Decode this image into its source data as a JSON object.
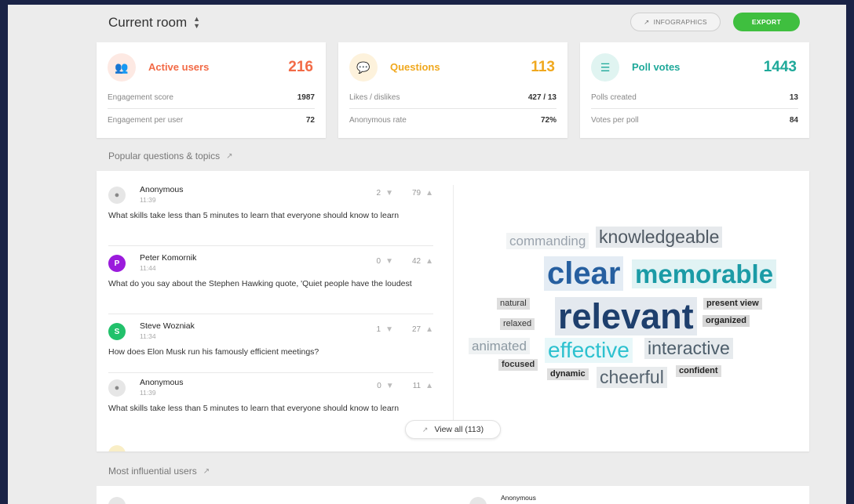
{
  "header": {
    "room_title": "Current room",
    "infographics_label": "INFOGRAPHICS",
    "export_label": "EXPORT"
  },
  "cards": [
    {
      "label": "Active users",
      "value": "216",
      "color": "#f26a46",
      "icon_bg": "#fde9e3",
      "icon": "users-icon",
      "rows": [
        {
          "label": "Engagement score",
          "value": "1987"
        },
        {
          "label": "Engagement per user",
          "value": "72"
        }
      ]
    },
    {
      "label": "Questions",
      "value": "113",
      "color": "#f0a81e",
      "icon_bg": "#fdf2dc",
      "icon": "speech-bubble-icon",
      "rows": [
        {
          "label": "Likes / dislikes",
          "value": "427 / 13"
        },
        {
          "label": "Anonymous rate",
          "value": "72%"
        }
      ]
    },
    {
      "label": "Poll votes",
      "value": "1443",
      "color": "#1fa99a",
      "icon_bg": "#e0f4f1",
      "icon": "poll-icon",
      "rows": [
        {
          "label": "Polls created",
          "value": "13"
        },
        {
          "label": "Votes per poll",
          "value": "84"
        }
      ]
    }
  ],
  "popular_section": {
    "title": "Popular questions & topics",
    "questions": [
      {
        "name": "Anonymous",
        "time": "11:39",
        "dislikes": "2",
        "likes": "79",
        "text": "What skills take less than 5 minutes to learn that everyone should know to learn",
        "avatar_letter": "",
        "avatar_color": "#e6e6e6"
      },
      {
        "name": "Peter Komornik",
        "time": "11:44",
        "dislikes": "0",
        "likes": "42",
        "text": "What do you say about the Stephen Hawking quote, 'Quiet people have the loudest",
        "avatar_letter": "P",
        "avatar_color": "#9b1bdc"
      },
      {
        "name": "Steve Wozniak",
        "time": "11:34",
        "dislikes": "1",
        "likes": "27",
        "text": "How does Elon Musk run his famously efficient meetings?",
        "avatar_letter": "S",
        "avatar_color": "#22c16b"
      },
      {
        "name": "Anonymous",
        "time": "11:39",
        "dislikes": "0",
        "likes": "11",
        "text": "What skills take less than 5 minutes to learn that everyone should know to learn",
        "avatar_letter": "",
        "avatar_color": "#e6e6e6"
      }
    ],
    "view_all_label": "View all (113)"
  },
  "word_cloud": [
    {
      "text": "commanding",
      "color": "#9aa3ad",
      "bg": "#f2f4f5"
    },
    {
      "text": "knowledgeable",
      "color": "#4f5963",
      "bg": "#e6e9ec"
    },
    {
      "text": "clear",
      "color": "#265fa0",
      "bg": "#e4ecf4"
    },
    {
      "text": "memorable",
      "color": "#1b9ba6",
      "bg": "#e1f3f4"
    },
    {
      "text": "natural",
      "color": "#333333",
      "bg": "#dedede"
    },
    {
      "text": "relevant",
      "color": "#1e3f6d",
      "bg": "#e4e9ef"
    },
    {
      "text": "present view",
      "color": "#222222",
      "bg": "#dedede"
    },
    {
      "text": "relaxed",
      "color": "#333333",
      "bg": "#dedede"
    },
    {
      "text": "organized",
      "color": "#222222",
      "bg": "#d6d6d6"
    },
    {
      "text": "animated",
      "color": "#8d9aa3",
      "bg": "#eff2f3"
    },
    {
      "text": "effective",
      "color": "#2cc1cf",
      "bg": "#e8f7f9"
    },
    {
      "text": "interactive",
      "color": "#4d5e6b",
      "bg": "#e6eaed"
    },
    {
      "text": "focused",
      "color": "#333333",
      "bg": "#dedede"
    },
    {
      "text": "dynamic",
      "color": "#222222",
      "bg": "#dedede"
    },
    {
      "text": "cheerful",
      "color": "#54626e",
      "bg": "#e8ebed"
    },
    {
      "text": "confident",
      "color": "#222222",
      "bg": "#dedede"
    }
  ],
  "influential_section": {
    "title": "Most influential users",
    "user_name": "Anonymous"
  }
}
